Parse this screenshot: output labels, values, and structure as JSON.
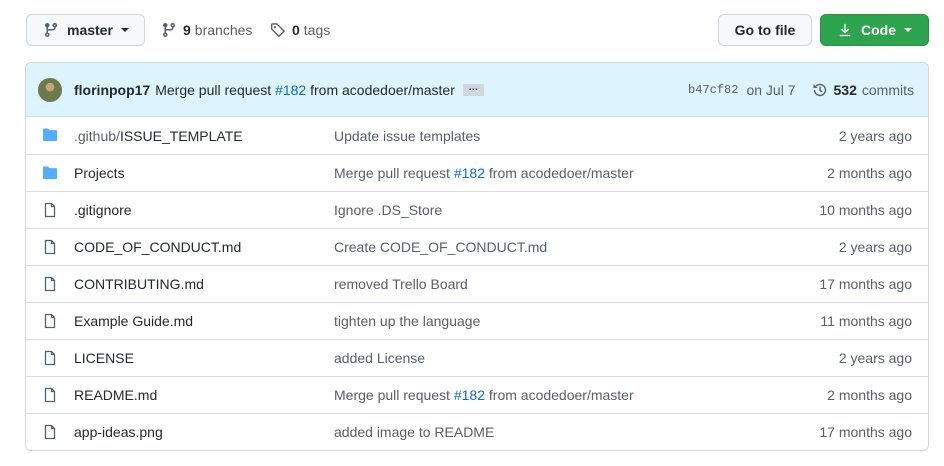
{
  "toolbar": {
    "branch": "master",
    "branches_count": "9",
    "branches_label": "branches",
    "tags_count": "0",
    "tags_label": "tags",
    "go_to_file": "Go to file",
    "code": "Code"
  },
  "colors": {
    "accent_green": "#2da44e",
    "link_blue": "#0969da",
    "folder_blue": "#54aeff",
    "commit_bar_bg": "#ddf4ff"
  },
  "commit": {
    "author": "florinpop17",
    "message_prefix": "Merge pull request",
    "pr": "#182",
    "message_suffix": "from acodedoer/master",
    "ellipsis": "…",
    "sha": "b47cf82",
    "date": "on Jul 7",
    "commits_count": "532",
    "commits_label": "commits"
  },
  "files": [
    {
      "type": "folder-icon",
      "dir": ".github/",
      "name": "ISSUE_TEMPLATE",
      "msg": "Update issue templates",
      "age": "2 years ago"
    },
    {
      "type": "folder-icon",
      "dir": "",
      "name": "Projects",
      "msg_prefix": "Merge pull request",
      "msg_link": "#182",
      "msg_suffix": "from acodedoer/master",
      "age": "2 months ago"
    },
    {
      "type": "file-icon",
      "dir": "",
      "name": ".gitignore",
      "msg": "Ignore .DS_Store",
      "age": "10 months ago"
    },
    {
      "type": "file-icon",
      "dir": "",
      "name": "CODE_OF_CONDUCT.md",
      "msg": "Create CODE_OF_CONDUCT.md",
      "age": "2 years ago"
    },
    {
      "type": "file-icon",
      "dir": "",
      "name": "CONTRIBUTING.md",
      "msg": "removed Trello Board",
      "age": "17 months ago"
    },
    {
      "type": "file-icon",
      "dir": "",
      "name": "Example Guide.md",
      "msg": "tighten up the language",
      "age": "11 months ago"
    },
    {
      "type": "file-icon",
      "dir": "",
      "name": "LICENSE",
      "msg": "added License",
      "age": "2 years ago"
    },
    {
      "type": "file-icon",
      "dir": "",
      "name": "README.md",
      "msg_prefix": "Merge pull request",
      "msg_link": "#182",
      "msg_suffix": "from acodedoer/master",
      "age": "2 months ago"
    },
    {
      "type": "file-icon",
      "dir": "",
      "name": "app-ideas.png",
      "msg": "added image to README",
      "age": "17 months ago"
    }
  ]
}
